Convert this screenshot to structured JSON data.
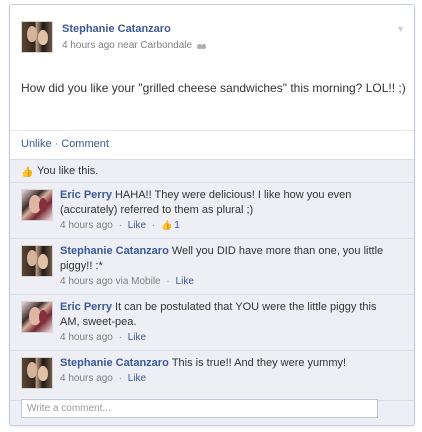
{
  "post": {
    "author": "Stephanie Catanzaro",
    "meta": "4 hours ago near Carbondale",
    "audience_icon": "people-icon",
    "menu_icon": "chevron-down-icon",
    "status_text": "How did you like your \"grilled cheese sandwiches\" this morning? LOL!! ;)"
  },
  "actions": {
    "unlike": "Unlike",
    "separator": "·",
    "comment": "Comment"
  },
  "likes": {
    "text": "You like this.",
    "icon": "thumbs-up-icon"
  },
  "comments": [
    {
      "author": "Eric Perry",
      "text": "HAHA!! They were delicious! I like how you even (accurately) referred to them as plural ;)",
      "time": "4 hours ago",
      "separator": "·",
      "like": "Like",
      "like_separator": "·",
      "like_count": "1"
    },
    {
      "author": "Stephanie Catanzaro",
      "text": "Well you DID have more than one, you little piggy!! :*",
      "time": "4 hours ago via Mobile",
      "separator": "·",
      "like": "Like"
    },
    {
      "author": "Eric Perry",
      "text": "It can be postulated that YOU were the little piggy this AM, sweet-pea.",
      "time": "4 hours ago",
      "separator": "·",
      "like": "Like"
    },
    {
      "author": "Stephanie Catanzaro",
      "text": "This is true!! And they were yummy!",
      "time": "4 hours ago",
      "separator": "·",
      "like": "Like"
    }
  ],
  "composer": {
    "placeholder": "Write a comment..."
  },
  "colors": {
    "link_blue": "#3b5998",
    "feedback_background": "#edeff4",
    "border": "#c4cde0"
  }
}
